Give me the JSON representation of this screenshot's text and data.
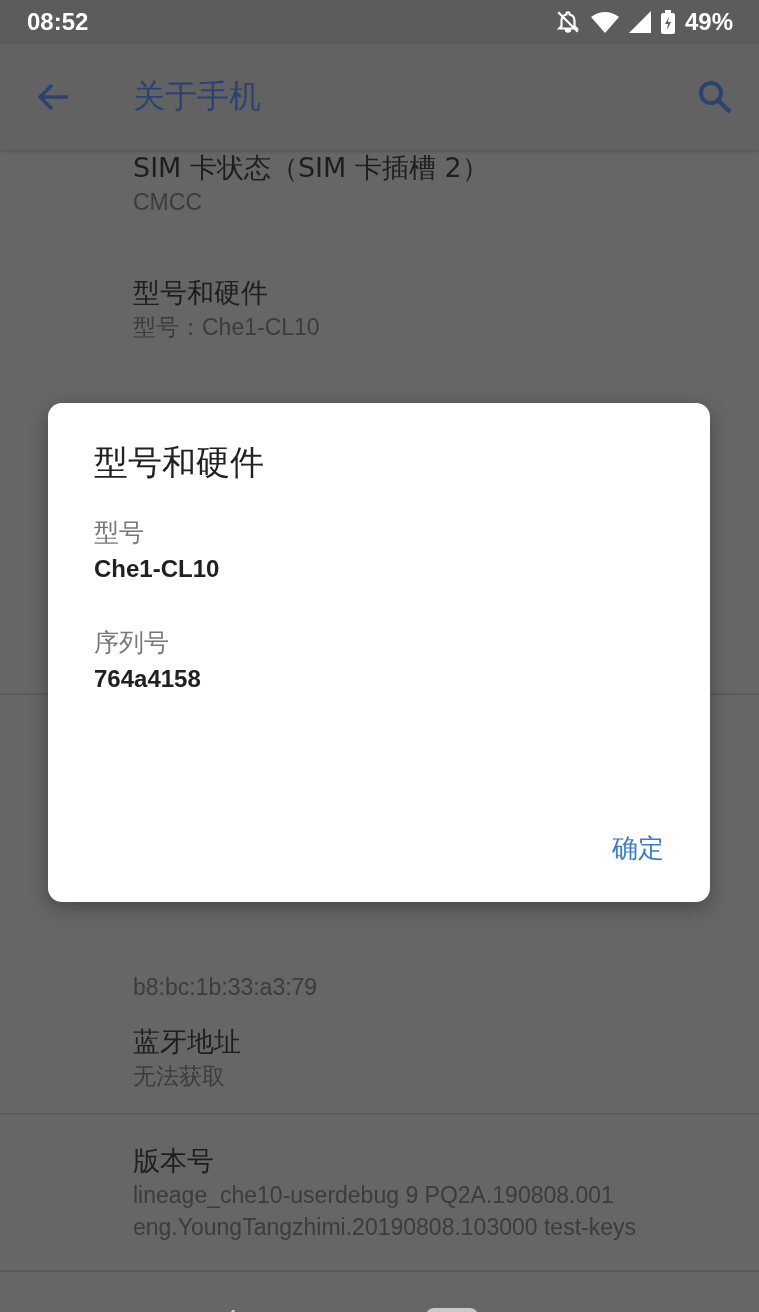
{
  "status_bar": {
    "time": "08:52",
    "battery": "49%"
  },
  "app_bar": {
    "title": "关于手机"
  },
  "list": [
    {
      "title": "SIM 卡状态（SIM 卡插槽 2）",
      "summary": "CMCC",
      "kind": "item"
    },
    {
      "title": "型号和硬件",
      "summary": "型号：Che1-CL10",
      "kind": "item"
    },
    {
      "kind": "hidden"
    },
    {
      "summary": "b8:bc:1b:33:a3:79",
      "kind": "partial"
    },
    {
      "title": "蓝牙地址",
      "summary": "无法获取",
      "kind": "item"
    },
    {
      "title": "版本号",
      "summary": "lineage_che10-userdebug 9 PQ2A.190808.001 eng.YoungTangzhimi.20190808.103000 test-keys",
      "kind": "item"
    }
  ],
  "dialog": {
    "title": "型号和硬件",
    "fields": [
      {
        "label": "型号",
        "value": "Che1-CL10"
      },
      {
        "label": "序列号",
        "value": "764a4158"
      }
    ],
    "button": "确定"
  }
}
